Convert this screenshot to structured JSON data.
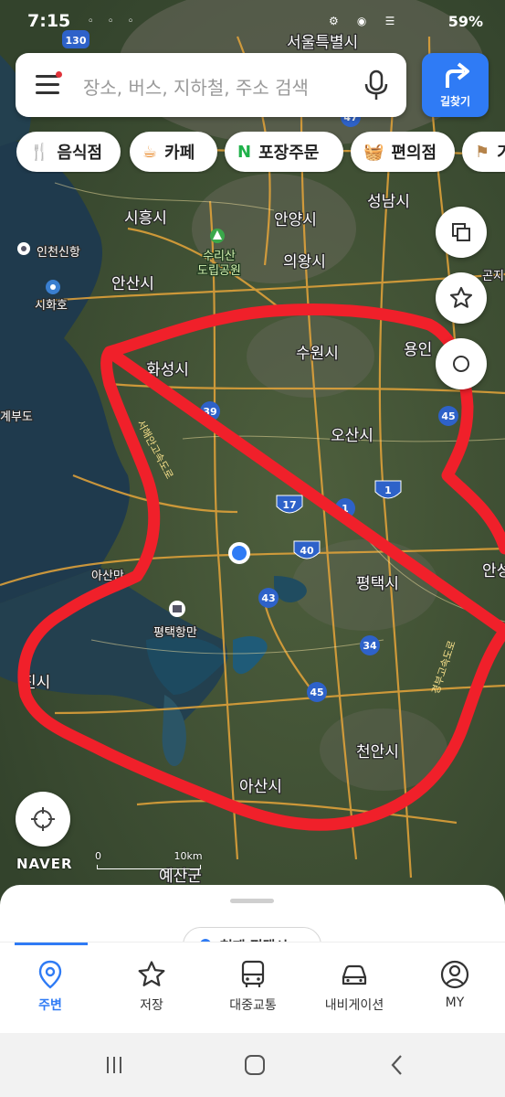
{
  "status": {
    "time": "7:15",
    "battery": "59%",
    "indicator_icons": "◦ ◦ ◦",
    "system_icons": "⚙ ◉ ☰"
  },
  "search": {
    "placeholder": "장소, 버스, 지하철, 주소 검색"
  },
  "route_button": {
    "label": "길찾기"
  },
  "chips": [
    {
      "label": "음식점",
      "icon": "fork-knife-icon",
      "glyph": "🍴"
    },
    {
      "label": "카페",
      "icon": "coffee-cup-icon",
      "glyph": "☕"
    },
    {
      "label": "포장주문",
      "icon": "naver-n-icon",
      "glyph": "N"
    },
    {
      "label": "편의점",
      "icon": "basket-icon",
      "glyph": "🧺"
    },
    {
      "label": "기",
      "icon": "flag-icon",
      "glyph": "⚑"
    }
  ],
  "map": {
    "labels": {
      "seoul": "서울특별시",
      "siheung": "시흥시",
      "anyang": "안양시",
      "seongnam": "성남시",
      "incheon_port": "인천신항",
      "suri": "수리산",
      "suri_park": "도립공원",
      "uiwang": "의왕시",
      "ansan": "안산시",
      "sihwa": "시화호",
      "suwon": "수원시",
      "yongin": "용인",
      "hwaseong": "화성시",
      "osan": "오산시",
      "pyeongtaek": "평택시",
      "pyeongtaek_port": "평택항만",
      "dangjin": "진시",
      "cheonan": "천안시",
      "asan": "아산시",
      "yesan": "예산군",
      "anseong": "안성",
      "ganghwa_left": "계부도",
      "asanman": "아산만",
      "expressway_west": "서해안고속도로",
      "expressway_gyeongbu": "경부고속도로",
      "gonji": "곤지"
    },
    "shields": [
      "130",
      "47",
      "39",
      "17",
      "1",
      "1",
      "40",
      "43",
      "45",
      "34",
      "45"
    ]
  },
  "naver_logo": "NAVER",
  "scale": {
    "zero": "0",
    "distance": "10km"
  },
  "sheet": {
    "location_chip": "현재 평택시"
  },
  "tabs": [
    {
      "label": "주변",
      "icon": "location-pin-icon",
      "active": true
    },
    {
      "label": "저장",
      "icon": "star-icon",
      "active": false
    },
    {
      "label": "대중교통",
      "icon": "bus-icon",
      "active": false
    },
    {
      "label": "내비게이션",
      "icon": "car-icon",
      "active": false
    },
    {
      "label": "MY",
      "icon": "user-icon",
      "active": false
    }
  ],
  "colors": {
    "accent": "#2f7bf5",
    "annotation": "#f0202a"
  }
}
